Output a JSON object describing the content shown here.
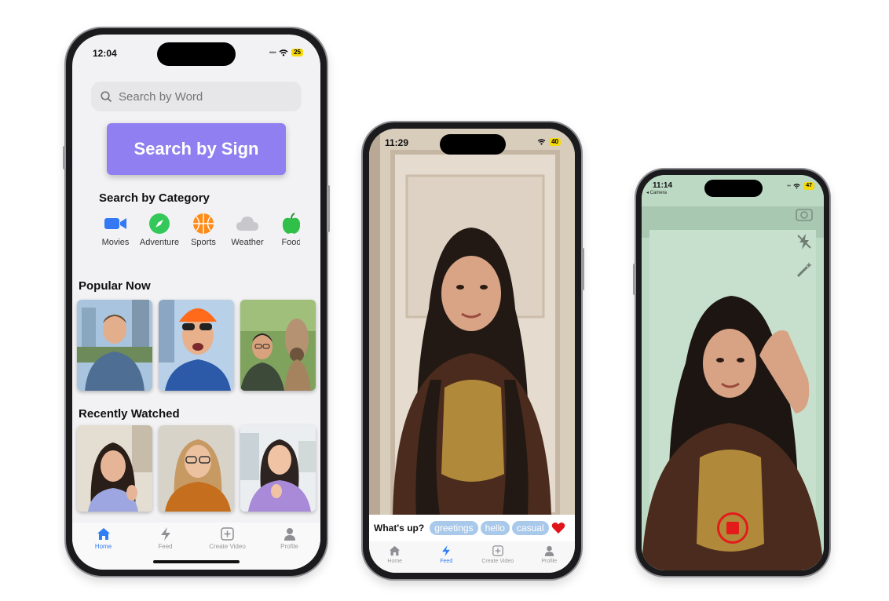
{
  "phone1": {
    "status": {
      "time": "12:04",
      "battery": "25"
    },
    "search": {
      "placeholder": "Search by Word"
    },
    "search_sign_label": "Search by Sign",
    "category_title": "Search by Category",
    "categories": [
      {
        "label": "Movies",
        "icon": "video-camera-icon",
        "color": "#3478f6"
      },
      {
        "label": "Adventure",
        "icon": "compass-icon",
        "color": "#34c759"
      },
      {
        "label": "Sports",
        "icon": "basketball-icon",
        "color": "#ff8c1a"
      },
      {
        "label": "Weather",
        "icon": "cloud-icon",
        "color": "#c7c7cc"
      },
      {
        "label": "Food",
        "icon": "apple-icon",
        "color": "#30c04a"
      }
    ],
    "popular_title": "Popular Now",
    "recent_title": "Recently Watched",
    "tabs": [
      {
        "label": "Home",
        "icon": "house-icon"
      },
      {
        "label": "Feed",
        "icon": "bolt-icon"
      },
      {
        "label": "Create Video",
        "icon": "plus-square-icon"
      },
      {
        "label": "Profile",
        "icon": "person-icon"
      }
    ]
  },
  "phone2": {
    "status": {
      "time": "11:29",
      "battery": "40"
    },
    "caption_question": "What's up?",
    "chips": [
      "greetings",
      "hello",
      "casual"
    ],
    "tabs": [
      {
        "label": "Home",
        "icon": "house-icon"
      },
      {
        "label": "Feed",
        "icon": "bolt-icon"
      },
      {
        "label": "Create Video",
        "icon": "plus-square-icon"
      },
      {
        "label": "Profile",
        "icon": "person-icon"
      }
    ]
  },
  "phone3": {
    "status": {
      "time": "11:14",
      "battery": "47",
      "back_label": "◂ Camera"
    }
  },
  "colors": {
    "accent": "#8f7ff0",
    "active_tab": "#2f7ef5",
    "chip": "#a9c9ea",
    "record": "#e31b1b"
  }
}
